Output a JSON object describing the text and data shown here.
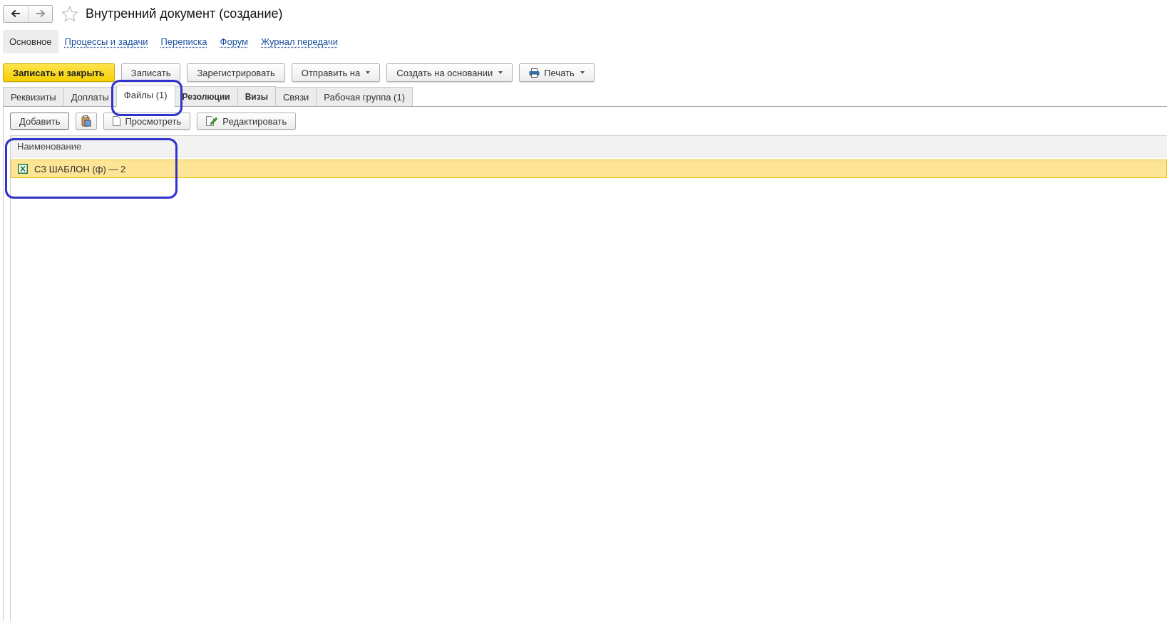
{
  "window": {
    "title": "Внутренний документ (создание)",
    "favorite": false
  },
  "nav_links": [
    {
      "label": "Основное",
      "selected": true
    },
    {
      "label": "Процессы и задачи",
      "selected": false
    },
    {
      "label": "Переписка",
      "selected": false
    },
    {
      "label": "Форум",
      "selected": false
    },
    {
      "label": "Журнал передачи",
      "selected": false
    }
  ],
  "toolbar": [
    {
      "label": "Записать и закрыть",
      "kind": "primary"
    },
    {
      "label": "Записать",
      "kind": "plain"
    },
    {
      "label": "Зарегистрировать",
      "kind": "plain"
    },
    {
      "label": "Отправить на",
      "kind": "dropdown"
    },
    {
      "label": "Создать на основании",
      "kind": "dropdown"
    },
    {
      "label": "Печать",
      "kind": "print"
    }
  ],
  "tabs": [
    {
      "label": "Реквизиты",
      "selected": false,
      "bold": false
    },
    {
      "label": "Доплаты",
      "selected": false,
      "bold": false
    },
    {
      "label": "Файлы (1)",
      "selected": true,
      "bold": false
    },
    {
      "label": "Резолюции",
      "selected": false,
      "bold": true
    },
    {
      "label": "Визы",
      "selected": false,
      "bold": true
    },
    {
      "label": "Связи",
      "selected": false,
      "bold": false
    },
    {
      "label": "Рабочая группа (1)",
      "selected": false,
      "bold": false
    }
  ],
  "files_toolbar": [
    {
      "label": "Добавить",
      "kind": "plain"
    },
    {
      "kind": "clipboard"
    },
    {
      "label": "Просмотреть",
      "kind": "view"
    },
    {
      "label": "Редактировать",
      "kind": "edit"
    }
  ],
  "table": {
    "columns": [
      "Наименование"
    ],
    "rows": [
      {
        "name": "СЗ ШАБЛОН (ф) — 2",
        "selected": true
      }
    ]
  }
}
